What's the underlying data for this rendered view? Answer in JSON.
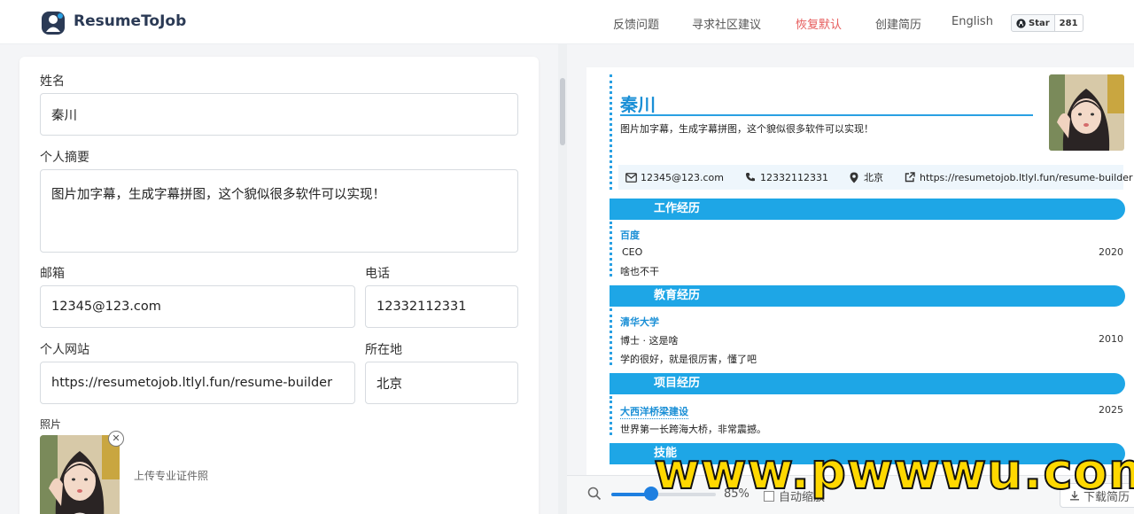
{
  "header": {
    "brand": "ResumeToJob",
    "nav": [
      "反馈问题",
      "寻求社区建议",
      "恢复默认",
      "创建简历",
      "English"
    ],
    "github": {
      "star_label": "Star",
      "count": "281"
    }
  },
  "form": {
    "name_label": "姓名",
    "name_value": "秦川",
    "summary_label": "个人摘要",
    "summary_value": "图片加字幕，生成字幕拼图，这个貌似很多软件可以实现！",
    "email_label": "邮箱",
    "email_value": "12345@123.com",
    "phone_label": "电话",
    "phone_value": "12332112331",
    "website_label": "个人网站",
    "website_value": "https://resumetojob.ltlyl.fun/resume-builder",
    "location_label": "所在地",
    "location_value": "北京",
    "photo_label": "照片",
    "upload_hint": "上传专业证件照"
  },
  "resume": {
    "name": "秦川",
    "summary": "图片加字幕，生成字幕拼图，这个貌似很多软件可以实现！",
    "contact": {
      "email": "12345@123.com",
      "phone": "12332112331",
      "location": "北京",
      "website": "https://resumetojob.ltlyl.fun/resume-builder"
    },
    "sections": {
      "work": {
        "title": "工作经历",
        "company": "百度",
        "role": "CEO",
        "year": "2020",
        "desc": "啥也不干"
      },
      "education": {
        "title": "教育经历",
        "school": "清华大学",
        "degree": "博士 · 这是啥",
        "year": "2010",
        "desc": "学的很好，就是很厉害，懂了吧"
      },
      "projects": {
        "title": "项目经历",
        "name": "大西洋桥梁建设",
        "year": "2025",
        "desc": "世界第一长跨海大桥，非常震撼。"
      },
      "skills": {
        "title": "技能"
      }
    }
  },
  "toolbar": {
    "zoom": "85%",
    "zoom_fraction": 0.38,
    "autofit_label": "自动缩放",
    "download_label": "下载简历"
  },
  "watermark": "www.pwwwu.com",
  "colors": {
    "accent": "#1ea6e6",
    "link_text": "#1a8fd6",
    "reset_red": "#e65b5b",
    "slider_blue": "#1e7fe0",
    "watermark_yellow": "#ffd800"
  }
}
